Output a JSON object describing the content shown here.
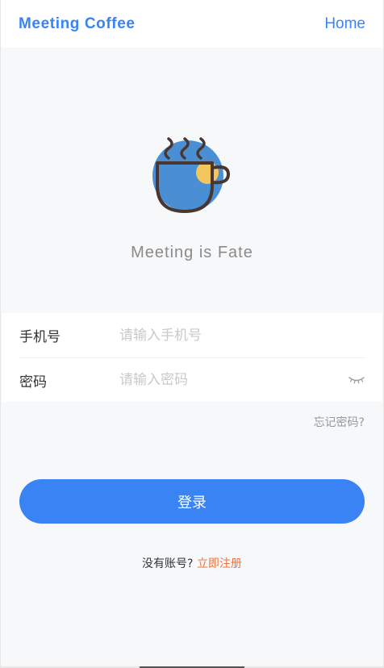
{
  "header": {
    "brand": "Meeting Coffee",
    "home_link": "Home"
  },
  "logo": {
    "icon": "coffee-cup-icon",
    "colors": {
      "circle": "#4a8fd4",
      "cup_outline": "#4a3630",
      "sun": "#f2c65c"
    }
  },
  "slogan": "Meeting is Fate",
  "form": {
    "phone": {
      "label": "手机号",
      "placeholder": "请输入手机号",
      "value": ""
    },
    "password": {
      "label": "密码",
      "placeholder": "请输入密码",
      "value": "",
      "toggle_icon": "eye-closed-icon"
    }
  },
  "forgot_password": "忘记密码?",
  "login_button": "登录",
  "register": {
    "prompt": "没有账号? ",
    "link": "立即注册"
  },
  "colors": {
    "accent": "#3a83f5",
    "link_orange": "#ee7440",
    "placeholder": "#c8c9cc",
    "background": "#f7f8fa"
  }
}
